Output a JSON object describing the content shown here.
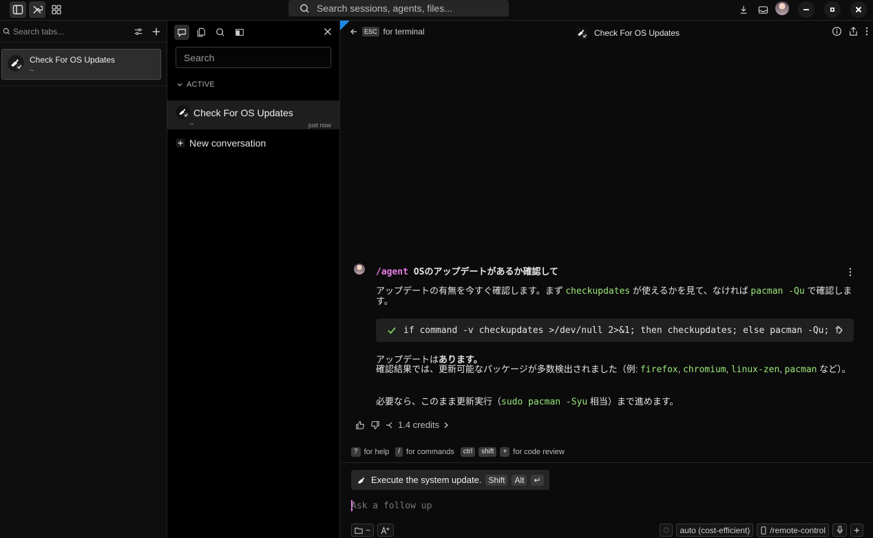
{
  "topbar": {
    "search_placeholder": "Search sessions, agents, files..."
  },
  "tabs_panel": {
    "search_placeholder": "Search tabs...",
    "tab": {
      "title": "Check For OS Updates",
      "subtitle": "~"
    }
  },
  "conversations": {
    "search_placeholder": "Search",
    "section_label": "ACTIVE",
    "item": {
      "title": "Check For OS Updates",
      "subtitle": "~",
      "time": "just now"
    },
    "new_label": "New conversation"
  },
  "main": {
    "esc_key": "ESC",
    "back_label": "for terminal",
    "title": "Check For OS Updates",
    "prompt": {
      "command": "/agent",
      "text": " OSのアップデートがあるか確認して"
    },
    "reply1": {
      "a": "アップデートの有無を今すぐ確認します。まず ",
      "code1": "checkupdates",
      "b": " が使えるかを見て、なければ ",
      "code2": "pacman -Qu",
      "c": " で確認します。"
    },
    "command_block": "if command -v checkupdates >/dev/null 2>&1; then checkupdates; else pacman -Qu; fi",
    "reply2": {
      "line1a": "アップデートは",
      "line1b": "あります。",
      "line2a": "確認結果では、更新可能なパッケージが多数検出されました（例: ",
      "pkg1": "firefox",
      "sep1": ", ",
      "pkg2": "chromium",
      "sep2": ", ",
      "pkg3": "linux-zen",
      "sep3": ", ",
      "pkg4": "pacman",
      "line2b": " など）。"
    },
    "reply3": {
      "a": "必要なら、このまま更新実行（",
      "code": "sudo pacman -Syu",
      "b": " 相当）まで進めます。"
    },
    "credits": "1.4 credits",
    "hints": {
      "help_key": "?",
      "help_label": "for help",
      "cmd_key": "/",
      "cmd_label": "for commands",
      "ctrl_key": "ctrl",
      "shift_key": "shift",
      "plus_key": "+",
      "review_label": "for code review"
    },
    "suggestion": {
      "text": "Execute the system update.",
      "key1": "Shift",
      "key2": "Alt",
      "key3": "↵"
    },
    "followup_placeholder": "Ask a follow up",
    "dir_label": "~",
    "model_label": "auto (cost-efficient)",
    "remote_label": "/remote-control"
  }
}
